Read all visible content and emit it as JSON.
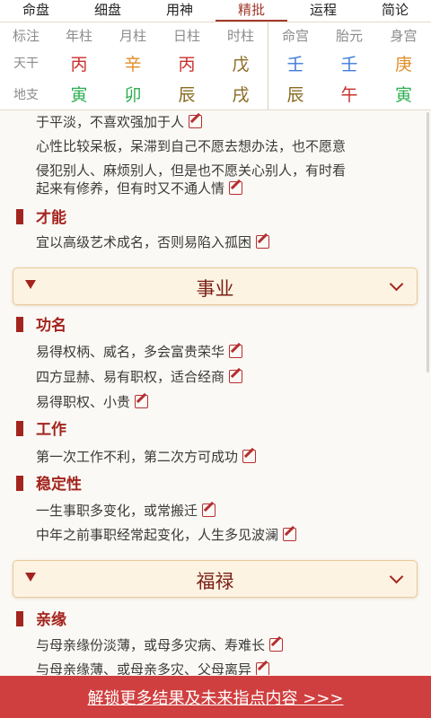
{
  "tabs": [
    "命盘",
    "细盘",
    "用神",
    "精批",
    "运程",
    "简论"
  ],
  "pillars": {
    "headers": [
      "标注",
      "年柱",
      "月柱",
      "日柱",
      "时柱"
    ],
    "headers2": [
      "命宫",
      "胎元",
      "身宫"
    ],
    "row_labels": [
      "天干",
      "地支"
    ],
    "tiangan": [
      "丙",
      "辛",
      "丙",
      "戊"
    ],
    "dizhi": [
      "寅",
      "卯",
      "辰",
      "戌"
    ],
    "tiangan2": [
      "壬",
      "壬",
      "庚"
    ],
    "dizhi2": [
      "辰",
      "午",
      "寅"
    ],
    "colors": {
      "red": "#c9302c",
      "orange": "#e08f2a",
      "green": "#2cae52",
      "olive": "#8a6b22",
      "blue": "#3d7bd8"
    }
  },
  "content": {
    "line_a": "于平淡，不喜欢强加于人",
    "line_b1": "心性比较呆板，呆滞到自己不愿去想办法，也不愿意",
    "line_b2": "侵犯别人、麻烦别人，但是也不愿关心别人，有时看",
    "line_b3": "起来有修养，但有时又不通人情",
    "sec_caineng": "才能",
    "caineng_1": "宜以高级艺术成名，否则易陷入孤困",
    "banner_shiye": "事业",
    "sec_gongming": "功名",
    "gongming_1": "易得权柄、威名，多会富贵荣华",
    "gongming_2": "四方显赫、易有职权，适合经商",
    "gongming_3": "易得职权、小贵",
    "sec_gongzuo": "工作",
    "gongzuo_1": "第一次工作不利，第二次方可成功",
    "sec_wending": "稳定性",
    "wending_1": "一生事职多变化，或常搬迁",
    "wending_2": "中年之前事职经常起变化，人生多见波澜",
    "banner_fulu": "福禄",
    "sec_qinyuan": "亲缘",
    "qinyuan_1": "与母亲缘份淡薄，或母多灾病、寿难长",
    "qinyuan_2": "与母亲缘薄、或母亲多灾、父母离异"
  },
  "unlock_label": "解锁更多结果及未来指点内容 >>>"
}
